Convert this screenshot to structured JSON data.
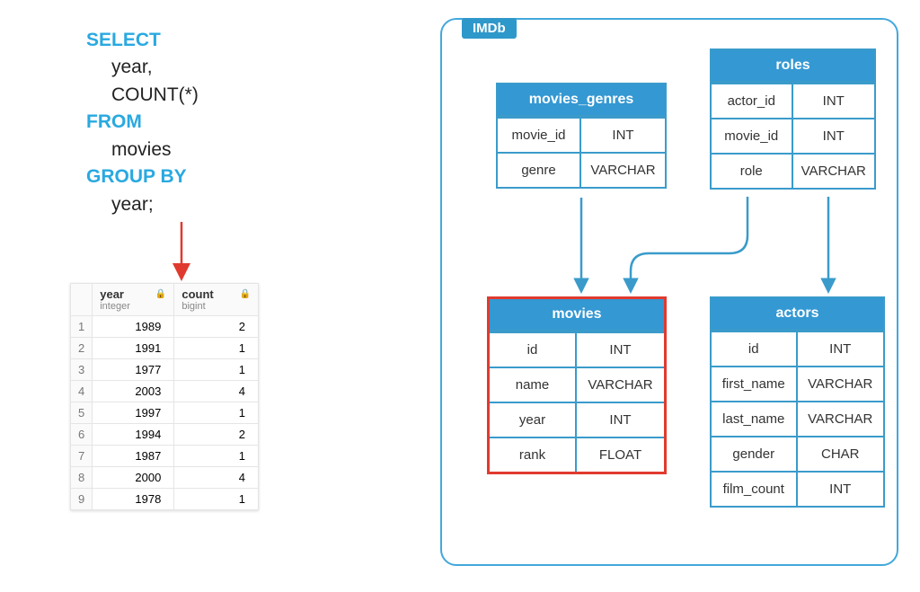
{
  "sql": {
    "kw_select": "SELECT",
    "col1": "year,",
    "col2": "COUNT(*)",
    "kw_from": "FROM",
    "table": "movies",
    "kw_groupby": "GROUP BY",
    "group_col": "year;"
  },
  "result": {
    "headers": [
      {
        "name": "year",
        "dtype": "integer"
      },
      {
        "name": "count",
        "dtype": "bigint"
      }
    ],
    "rows": [
      {
        "n": "1",
        "year": "1989",
        "count": "2"
      },
      {
        "n": "2",
        "year": "1991",
        "count": "1"
      },
      {
        "n": "3",
        "year": "1977",
        "count": "1"
      },
      {
        "n": "4",
        "year": "2003",
        "count": "4"
      },
      {
        "n": "5",
        "year": "1997",
        "count": "1"
      },
      {
        "n": "6",
        "year": "1994",
        "count": "2"
      },
      {
        "n": "7",
        "year": "1987",
        "count": "1"
      },
      {
        "n": "8",
        "year": "2000",
        "count": "4"
      },
      {
        "n": "9",
        "year": "1978",
        "count": "1"
      }
    ]
  },
  "schema": {
    "title": "IMDb",
    "tables": {
      "movies_genres": {
        "name": "movies_genres",
        "cols": [
          {
            "name": "movie_id",
            "type": "INT"
          },
          {
            "name": "genre",
            "type": "VARCHAR"
          }
        ]
      },
      "roles": {
        "name": "roles",
        "cols": [
          {
            "name": "actor_id",
            "type": "INT"
          },
          {
            "name": "movie_id",
            "type": "INT"
          },
          {
            "name": "role",
            "type": "VARCHAR"
          }
        ]
      },
      "movies": {
        "name": "movies",
        "cols": [
          {
            "name": "id",
            "type": "INT"
          },
          {
            "name": "name",
            "type": "VARCHAR"
          },
          {
            "name": "year",
            "type": "INT"
          },
          {
            "name": "rank",
            "type": "FLOAT"
          }
        ]
      },
      "actors": {
        "name": "actors",
        "cols": [
          {
            "name": "id",
            "type": "INT"
          },
          {
            "name": "first_name",
            "type": "VARCHAR"
          },
          {
            "name": "last_name",
            "type": "VARCHAR"
          },
          {
            "name": "gender",
            "type": "CHAR"
          },
          {
            "name": "film_count",
            "type": "INT"
          }
        ]
      }
    }
  },
  "icons": {
    "lock": "🔒"
  }
}
